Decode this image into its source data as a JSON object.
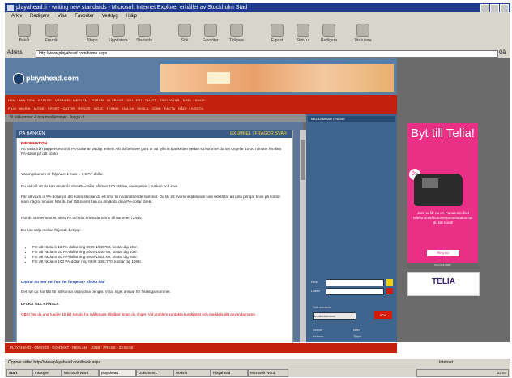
{
  "window": {
    "title": "playahead.fi - writing new standards - Microsoft Internet Explorer erhållet av Stockholm Stad"
  },
  "menu": [
    "Arkiv",
    "Redigera",
    "Visa",
    "Favoriter",
    "Verktyg",
    "Hjälp"
  ],
  "toolbar": [
    {
      "label": "Bakåt",
      "icon": "back-arrow-icon"
    },
    {
      "label": "Framåt",
      "icon": "forward-arrow-icon"
    },
    {
      "label": "Stopp",
      "icon": "stop-icon"
    },
    {
      "label": "Uppdatera",
      "icon": "refresh-icon"
    },
    {
      "label": "Startsida",
      "icon": "home-icon"
    },
    {
      "label": "Sök",
      "icon": "search-icon"
    },
    {
      "label": "Favoriter",
      "icon": "favorites-icon"
    },
    {
      "label": "Tidigare",
      "icon": "history-icon"
    },
    {
      "label": "E-post",
      "icon": "mail-icon"
    },
    {
      "label": "Skriv ut",
      "icon": "print-icon"
    },
    {
      "label": "Redigera",
      "icon": "edit-icon"
    },
    {
      "label": "Diskutera",
      "icon": "discuss-icon"
    }
  ],
  "address": {
    "label": "Adress",
    "url": "http://www.playahead.com/home.aspx",
    "go": "Gå"
  },
  "site": {
    "logo": "playahead.com",
    "nav_row1": "HEM · MIN SIDA · KÄRLEK · VÄNNER · MEDLEM · FORUM · KLUBBAR · GALLERI · CHATT · TÄVLINGAR · SPEL · SHOP",
    "nav_row2": "FILM · MUSIK · MODE · SPORT · DATOR · RESOR · NÖJE · TEKNIK · HÄLSA · SKOLA · JOBB · FAKTA · RÅD · LIVSSTIL",
    "gray_bar": "Vi välkomnar 4 nya medlemmar · logga ut",
    "article_title": "PÅ BANKEN",
    "article_links": "EXEMPEL | FRÅGOR SVAR",
    "heading_red": "INFORMATION",
    "p1": "Att växla från pappers euro till PA-dollar är väldigt enkelt! Allt du behöver göra är att fylla in blanketten nedan så kommer du om ungefär 10-20 minuter ha dina PA-dollar på ditt konto.",
    "p2": "Växlingskursen är följande: 1 euro = 3,5 PA-dollar.",
    "p3": "Du vet väl att du kan använda dina PA-dollar på över 100 ställen, exempelvis i butiken och spel.",
    "p4": "För att växla in PA-dollar på ditt konto skickar du ett sms till nedanstående nummer. Du får ett svarsmeddelande som bekräftar att dina pengar finns på kontot inom några minuter. När du har fått svaret kan du använda dina PA-dollar direkt.",
    "p5": "Hur du skriver sms:et: skriv PA och ditt användarnamn till nummer 72444.",
    "p6": "Du kan välja mellan följande belopp:",
    "list": [
      "För att växla in 10 PA-dollar ring 0939-1040750, kostar dig 10kr.",
      "För att växla in 20 PA-dollar ring 0939-1040760, kostar dig 20kr.",
      "För att växla in 50 PA-dollar ring 0939-1051760, kostar dig 50kr.",
      "För att växla in 100 PA-dollar ring 0939-1051770, kostar dig 100kr."
    ],
    "p7": "Undrar du mer om hur det fungerar? Klicka här!",
    "p8": "Det har du har fått för att kunna växla dina pengar. Vi tar inget ansvar för felaktiga nummer.",
    "p9": "LYCKA TILL KÄNSLA",
    "p10": "OBS! Var du ung (under 15 år) ska du ha målsmans tillstånd innan du ringer. Vid problem kontakta kundtjänst och meddela ditt användarnamn.",
    "right_head": "MEDLEMMAR ONLINE",
    "login_labels": [
      "Nick",
      "Lösen"
    ],
    "search_label": "Sök medlem",
    "search_placeholder": "Användarnamn",
    "search_button": "SÖK",
    "online_labels": [
      "Online",
      "Män",
      "Kvinnor",
      "Tjejer"
    ],
    "footer": "PLAYAHEAD · OM OSS · KONTAKT · REKLAM · JOBB · PRESS · 23:04:56"
  },
  "ads": {
    "telia_title": "Byt till Telia!",
    "telia_badge": "0:-",
    "telia_copy": "Just nu får du en Panasonic fast telefon med nummerpresentation när du blir kund!",
    "telia_cta": "Ring nu!",
    "strip": "KLICKA HÄR",
    "telia_logo": "TELIA"
  },
  "statusbar": {
    "text": "Öppnar sidan http://www.playahead.com/bank.aspx...",
    "zone": "Internet"
  },
  "taskbar": {
    "start": "Start",
    "tasks": [
      "Inkorgen",
      "Microsoft Word",
      "playahead",
      "Dokument1",
      "Utskrift",
      "Playahead",
      "Microsoft Word"
    ],
    "clock": "23:04"
  },
  "colors": {
    "site_red": "#c4200e",
    "site_blue": "#3f648e",
    "telia_pink": "#ea2f86"
  }
}
